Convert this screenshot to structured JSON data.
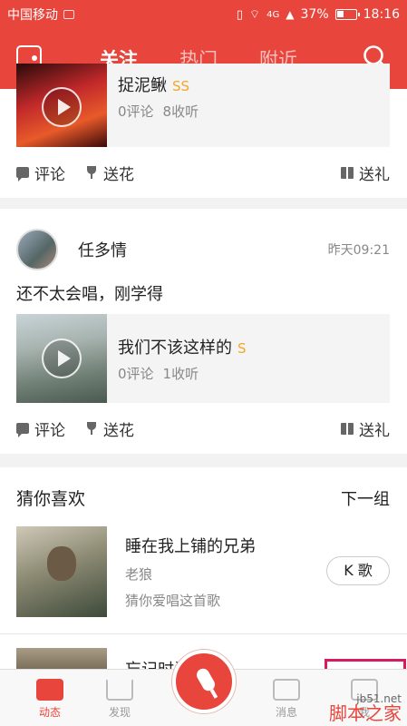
{
  "status_bar": {
    "carrier": "中国移动",
    "network": "4G",
    "battery": "37%",
    "time": "18:16"
  },
  "appbar": {
    "tabs": [
      "关注",
      "热门",
      "附近"
    ],
    "active_tab": "关注"
  },
  "feed": [
    {
      "song": {
        "title": "捉泥鳅",
        "badge": "SS",
        "comments": "0评论",
        "listens": "8收听"
      },
      "actions": {
        "comment": "评论",
        "flower": "送花",
        "gift": "送礼"
      }
    },
    {
      "user": {
        "name": "任多情",
        "time": "昨天09:21"
      },
      "text": "还不太会唱，刚学得",
      "song": {
        "title": "我们不该这样的",
        "badge": "S",
        "comments": "0评论",
        "listens": "1收听"
      },
      "actions": {
        "comment": "评论",
        "flower": "送花",
        "gift": "送礼"
      }
    }
  ],
  "recommend": {
    "title": "猜你喜欢",
    "next": "下一组",
    "items": [
      {
        "title": "睡在我上铺的兄弟",
        "artist": "老狼",
        "hint": "猜你爱唱这首歌",
        "button": "K 歌"
      },
      {
        "title": "忘记时间"
      }
    ]
  },
  "bottom_nav": {
    "items": [
      "动态",
      "发现",
      "消息",
      "我"
    ],
    "active": "动态"
  },
  "watermark": {
    "site": "jb51.net",
    "name": "脚本之家"
  },
  "colors": {
    "brand": "#e8453c",
    "badge": "#f5a623"
  }
}
